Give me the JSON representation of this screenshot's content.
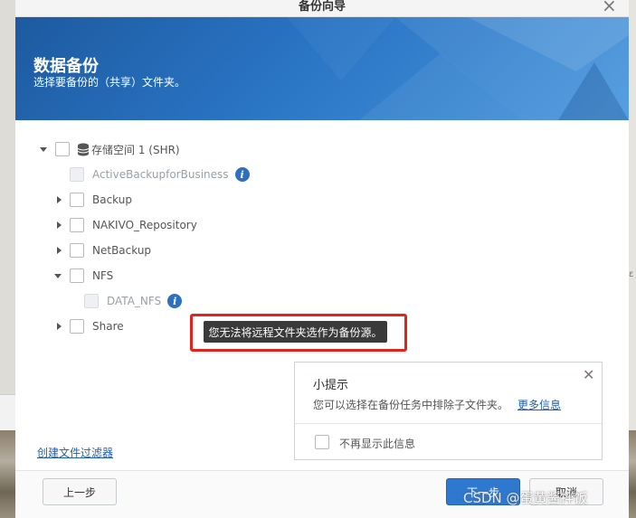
{
  "dialog": {
    "title": "备份向导",
    "close_icon": "close-icon",
    "banner": {
      "title": "数据备份",
      "subtitle": "选择要备份的（共享）文件夹。"
    }
  },
  "tree": {
    "root": {
      "label": "存储空间 1 (SHR)",
      "expanded": true,
      "icon": "database-icon"
    },
    "items": [
      {
        "label": "ActiveBackupforBusiness",
        "disabled": true,
        "info": true
      },
      {
        "label": "Backup",
        "expanded": false
      },
      {
        "label": "NAKIVO_Repository",
        "expanded": false
      },
      {
        "label": "NetBackup",
        "expanded": false
      },
      {
        "label": "NFS",
        "expanded": true
      },
      {
        "label": "DATA_NFS",
        "disabled": true,
        "info": true
      },
      {
        "label": "Share",
        "expanded": false
      }
    ],
    "info_glyph": "i"
  },
  "tooltip": {
    "text": "您无法将远程文件夹选作为备份源。"
  },
  "tip_panel": {
    "title": "小提示",
    "text": "您可以选择在备份任务中排除子文件夹。",
    "link": "更多信息",
    "checkbox_label": "不再显示此信息"
  },
  "filter_link": "创建文件过滤器",
  "buttons": {
    "back": "上一步",
    "next": "下一步",
    "cancel": "取消"
  },
  "watermark": "CSDN @蛋黄酱拌饭",
  "background": {
    "side_mark": "ε"
  },
  "colors": {
    "accent": "#2f78cf",
    "highlight": "#e2221c",
    "banner": "#2a74c4"
  }
}
